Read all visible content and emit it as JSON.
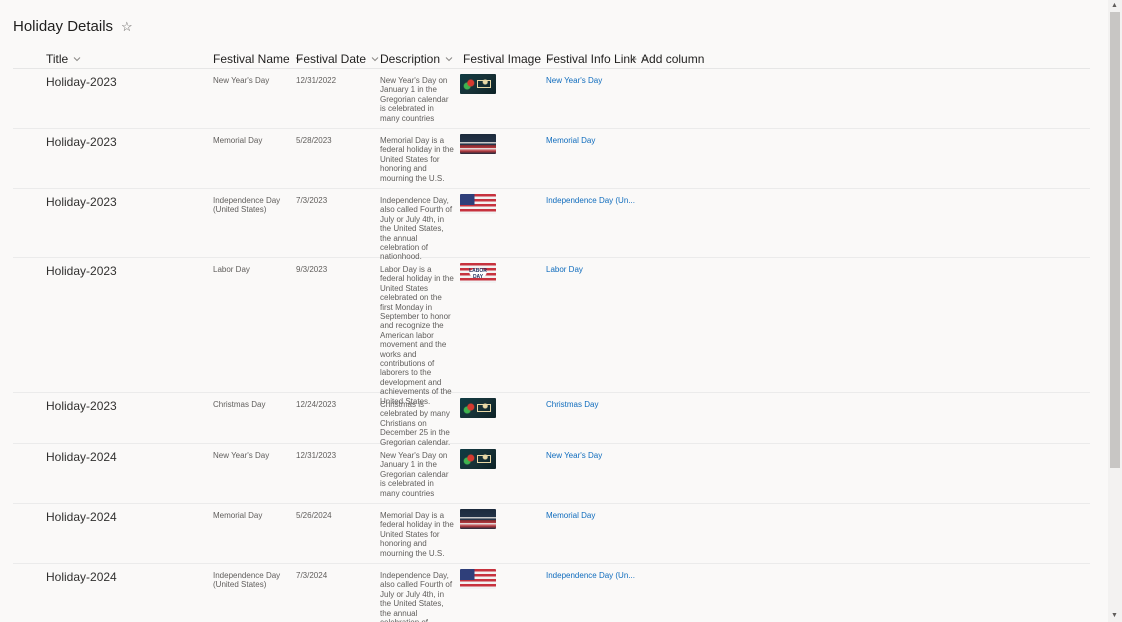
{
  "page": {
    "title": "Holiday Details"
  },
  "columns": {
    "title": "Title",
    "festival_name": "Festival Name",
    "festival_date": "Festival Date",
    "description": "Description",
    "festival_image": "Festival Image",
    "festival_info_link": "Festival Info Link",
    "add_column": "Add column"
  },
  "rows": [
    {
      "title": "Holiday-2023",
      "name": "New Year's Day",
      "date": "12/31/2022",
      "description": "New Year's Day on January 1 in the Gregorian calendar is celebrated in many countries",
      "image": "new-years-image",
      "link": "New Year's Day"
    },
    {
      "title": "Holiday-2023",
      "name": "Memorial Day",
      "date": "5/28/2023",
      "description": "Memorial Day is a federal holiday in the United States for honoring and mourning the U.S.",
      "image": "memorial-image",
      "link": "Memorial Day"
    },
    {
      "title": "Holiday-2023",
      "name": "Independence Day (United States)",
      "date": "7/3/2023",
      "description": "Independence Day, also called Fourth of July or July 4th, in the United States, the annual celebration of nationhood.",
      "image": "flag-image",
      "link": "Independence Day (Un..."
    },
    {
      "title": "Holiday-2023",
      "name": "Labor Day",
      "date": "9/3/2023",
      "description": "Labor Day is a federal holiday in the United States celebrated on the first Monday in September to honor and recognize the American labor movement and the works and contributions of laborers to the development and achievements of the United States.",
      "image": "labor-image",
      "link": "Labor Day"
    },
    {
      "title": "Holiday-2023",
      "name": "Christmas Day",
      "date": "12/24/2023",
      "description": "Christmas is celebrated by many Christians on December 25 in the Gregorian calendar.",
      "image": "new-years-image",
      "link": "Christmas Day"
    },
    {
      "title": "Holiday-2024",
      "name": "New Year's Day",
      "date": "12/31/2023",
      "description": "New Year's Day on January 1 in the Gregorian calendar is celebrated in many countries",
      "image": "new-years-image",
      "link": "New Year's Day"
    },
    {
      "title": "Holiday-2024",
      "name": "Memorial Day",
      "date": "5/26/2024",
      "description": "Memorial Day is a federal holiday in the United States for honoring and mourning the U.S.",
      "image": "memorial-image",
      "link": "Memorial Day"
    },
    {
      "title": "Holiday-2024",
      "name": "Independence Day (United States)",
      "date": "7/3/2024",
      "description": "Independence Day, also called Fourth of July or July 4th, in the United States, the annual celebration of nationhood.",
      "image": "flag-image",
      "link": "Independence Day (Un..."
    }
  ]
}
